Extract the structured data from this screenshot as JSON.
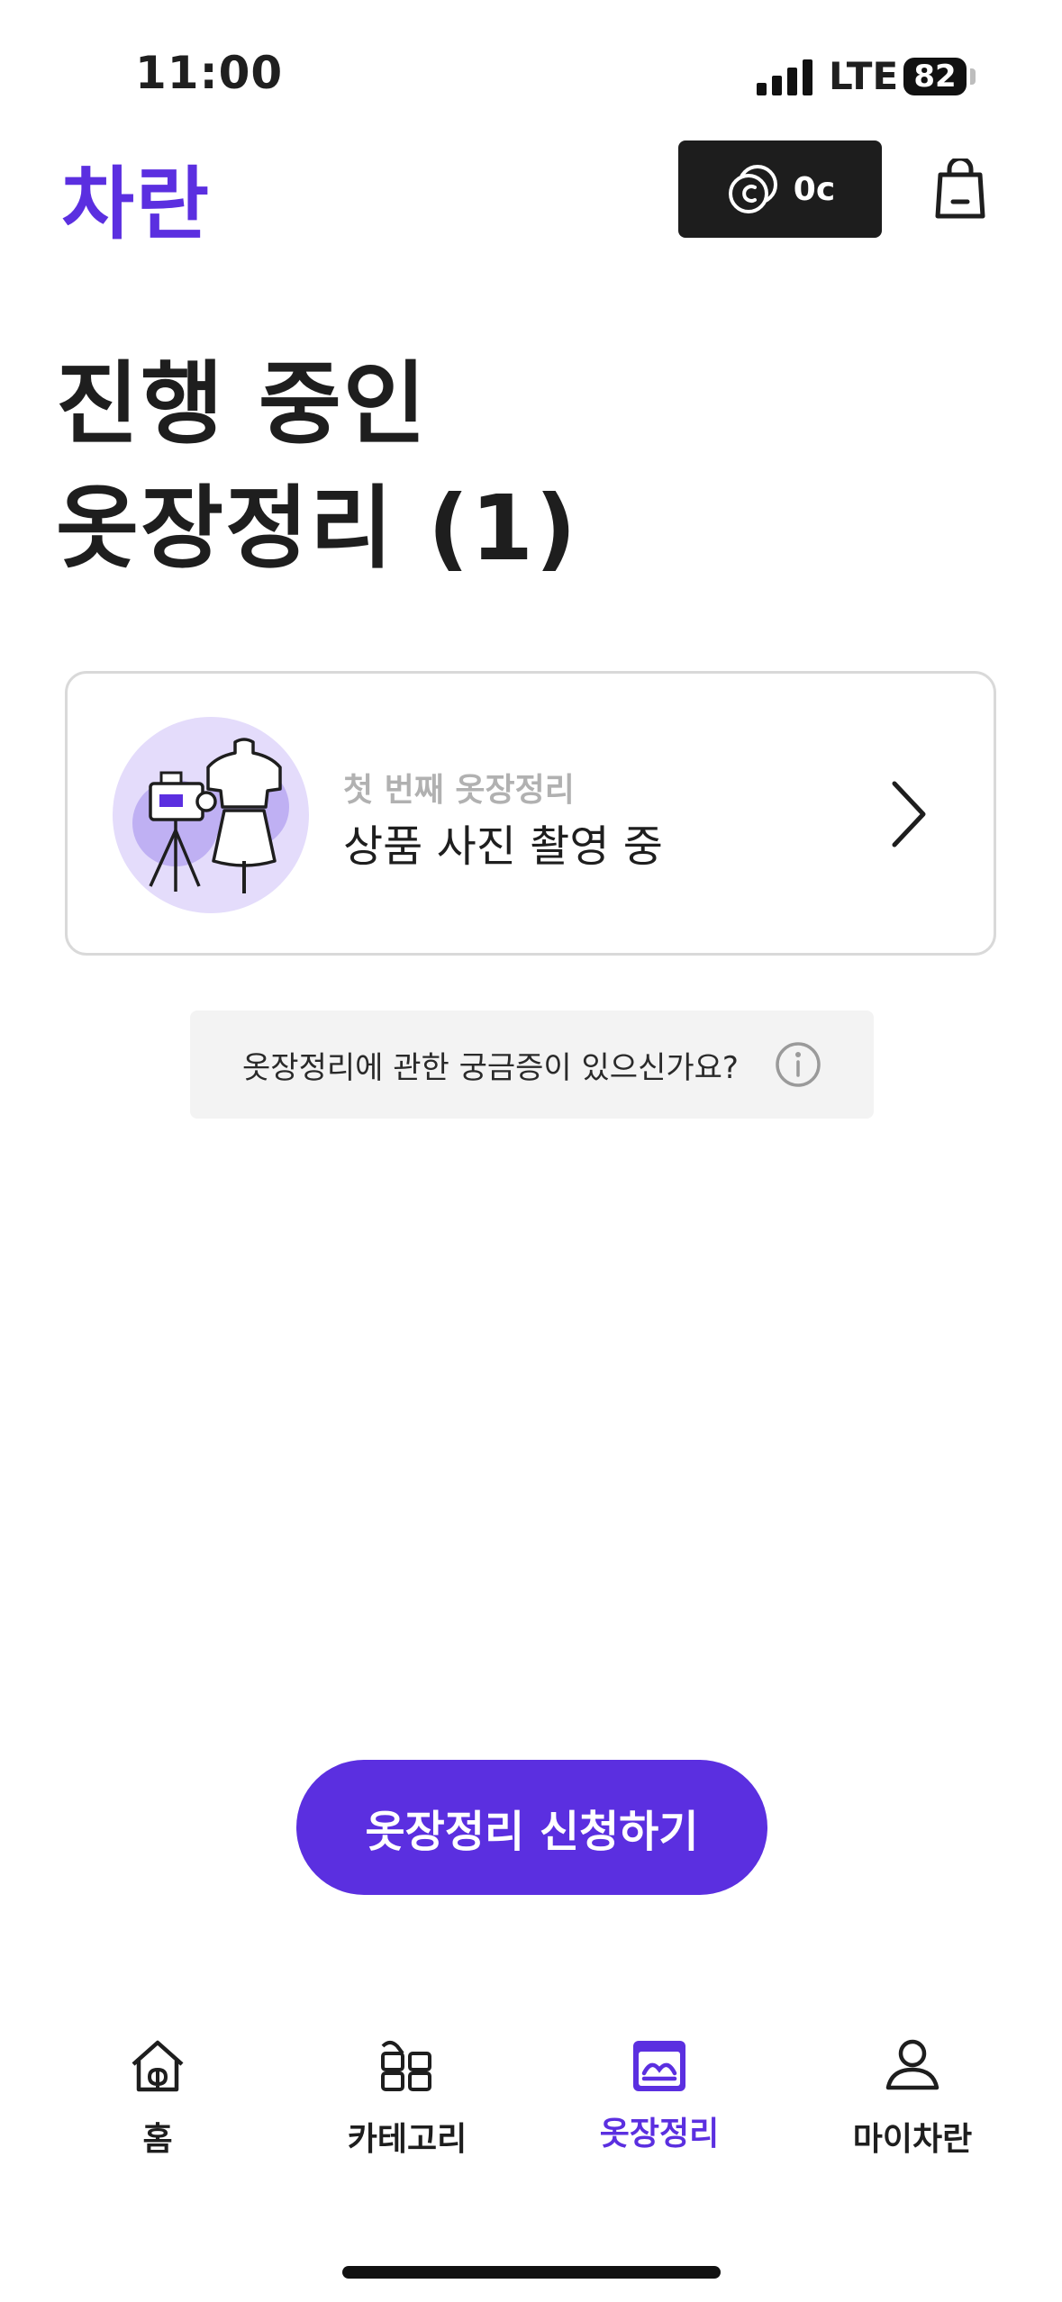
{
  "status_bar": {
    "time": "11:00",
    "network": "LTE",
    "battery": "82"
  },
  "header": {
    "logo": "차란",
    "credit_value": "0c",
    "credit_icon": "coins-icon",
    "cart_icon": "shopping-bag-icon"
  },
  "title": {
    "line1": "진행 중인",
    "line2": "옷장정리 (1)"
  },
  "card": {
    "subtitle": "첫 번째 옷장정리",
    "status": "상품 사진 촬영 중",
    "illustration": "photo-shoot-illustration"
  },
  "faq": {
    "text": "옷장정리에 관한 궁금증이 있으신가요?"
  },
  "cta": {
    "label": "옷장정리 신청하기"
  },
  "tabs": [
    {
      "label": "홈",
      "icon": "home-icon"
    },
    {
      "label": "카테고리",
      "icon": "category-icon"
    },
    {
      "label": "옷장정리",
      "icon": "closet-icon",
      "active": true
    },
    {
      "label": "마이차란",
      "icon": "profile-icon"
    }
  ],
  "colors": {
    "brand": "#5b2fe0",
    "dark_button": "#1d1d1d"
  }
}
